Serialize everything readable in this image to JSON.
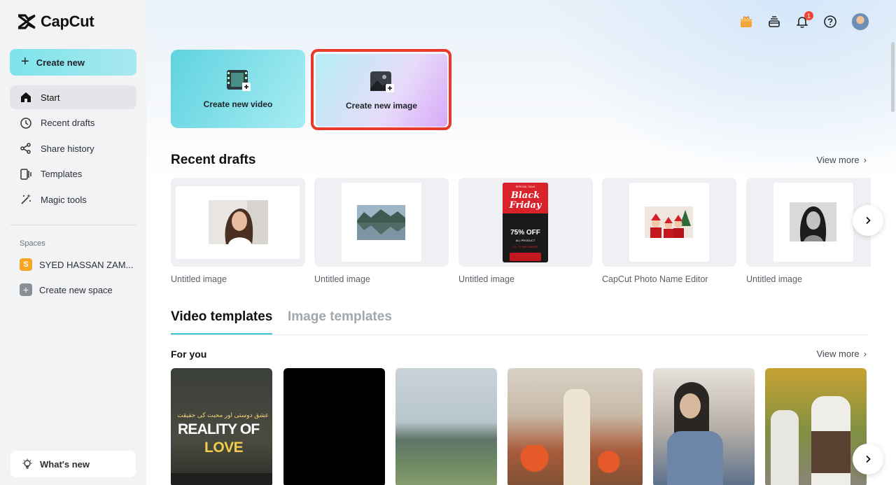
{
  "app": {
    "name": "CapCut"
  },
  "sidebar": {
    "create_new": "Create new",
    "nav": [
      {
        "label": "Start",
        "icon": "home-icon",
        "active": true
      },
      {
        "label": "Recent drafts",
        "icon": "clock-icon"
      },
      {
        "label": "Share history",
        "icon": "share-icon"
      },
      {
        "label": "Templates",
        "icon": "templates-icon"
      },
      {
        "label": "Magic tools",
        "icon": "magic-wand-icon"
      }
    ],
    "spaces_label": "Spaces",
    "space": {
      "initial": "S",
      "name": "SYED HASSAN ZAM..."
    },
    "create_space": "Create new space",
    "whats_new": "What's new"
  },
  "topbar": {
    "notification_count": "1",
    "icons": [
      "gift-icon",
      "stack-icon",
      "bell-icon",
      "help-icon",
      "avatar"
    ]
  },
  "create_cards": {
    "video": "Create new video",
    "image": "Create new image"
  },
  "recent_drafts": {
    "title": "Recent drafts",
    "view_more": "View more",
    "items": [
      {
        "label": "Untitled image"
      },
      {
        "label": "Untitled image"
      },
      {
        "label": "Untitled image",
        "poster_tag": "SPECIAL SALE",
        "poster_title": "Black Friday",
        "poster_offer": "75% OFF",
        "poster_sub": "ALL PRODUCT",
        "poster_date": "15 - 27 DECEMBER"
      },
      {
        "label": "CapCut Photo Name Editor"
      },
      {
        "label": "Untitled image"
      }
    ]
  },
  "templates": {
    "tab_video": "Video templates",
    "tab_image": "Image templates",
    "for_you": "For you",
    "view_more": "View more",
    "first_card": {
      "line1": "REALITY OF",
      "line2": "LOVE",
      "urdu": "عشق دوستی اور محبت کی حقیقت"
    }
  }
}
